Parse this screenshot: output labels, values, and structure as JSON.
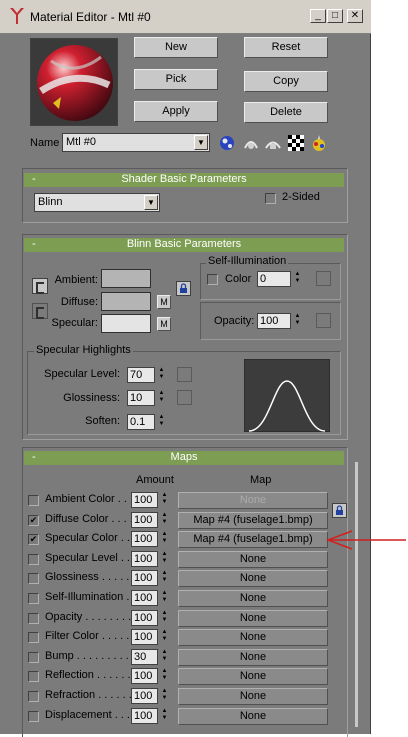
{
  "window": {
    "title": "Material Editor - Mtl #0",
    "minimize": "_",
    "maximize": "□",
    "close": "✕"
  },
  "top_buttons": {
    "new": "New",
    "reset": "Reset",
    "pick": "Pick",
    "copy": "Copy",
    "apply": "Apply",
    "delete": "Delete"
  },
  "name_row": {
    "label": "Name",
    "value": "Mtl #0"
  },
  "shader": {
    "title": "Shader Basic Parameters",
    "minus": "-",
    "shader_value": "Blinn",
    "two_sided": "2-Sided"
  },
  "blinn": {
    "title": "Blinn Basic Parameters",
    "minus": "-",
    "ambient": "Ambient:",
    "diffuse": "Diffuse:",
    "specular": "Specular:",
    "m": "M",
    "self_illum": {
      "title": "Self-Illumination",
      "color_label": "Color",
      "value": "0"
    },
    "opacity": {
      "label": "Opacity:",
      "value": "100"
    },
    "highlights": {
      "title": "Specular Highlights",
      "level_label": "Specular Level:",
      "level": "70",
      "gloss_label": "Glossiness:",
      "gloss": "10",
      "soften_label": "Soften:",
      "soften": "0.1"
    }
  },
  "maps": {
    "title": "Maps",
    "minus": "-",
    "amount_header": "Amount",
    "map_header": "Map",
    "rows": [
      {
        "label": "Ambient Color . . .",
        "checked": false,
        "amount": "100",
        "map": "None",
        "disabled": true
      },
      {
        "label": "Diffuse Color . . . .",
        "checked": true,
        "amount": "100",
        "map": "Map #4 (fuselage1.bmp)",
        "disabled": false
      },
      {
        "label": "Specular Color . .",
        "checked": true,
        "amount": "100",
        "map": "Map #4 (fuselage1.bmp)",
        "disabled": false
      },
      {
        "label": "Specular Level . .",
        "checked": false,
        "amount": "100",
        "map": "None",
        "disabled": false
      },
      {
        "label": "Glossiness  . . . . .",
        "checked": false,
        "amount": "100",
        "map": "None",
        "disabled": false
      },
      {
        "label": "Self-Illumination .",
        "checked": false,
        "amount": "100",
        "map": "None",
        "disabled": false
      },
      {
        "label": "Opacity . . . . . . . .",
        "checked": false,
        "amount": "100",
        "map": "None",
        "disabled": false
      },
      {
        "label": "Filter Color  . . . . .",
        "checked": false,
        "amount": "100",
        "map": "None",
        "disabled": false
      },
      {
        "label": "Bump  . . . . . . . . .",
        "checked": false,
        "amount": "30",
        "map": "None",
        "disabled": false
      },
      {
        "label": "Reflection  . . . . . .",
        "checked": false,
        "amount": "100",
        "map": "None",
        "disabled": false
      },
      {
        "label": "Refraction  . . . . . .",
        "checked": false,
        "amount": "100",
        "map": "None",
        "disabled": false
      },
      {
        "label": "Displacement  . . .",
        "checked": false,
        "amount": "100",
        "map": "None",
        "disabled": false
      }
    ]
  },
  "colors": {
    "panel": "#7b7b7b",
    "rollout": "#7d9e52",
    "annotation_arrow": "#d02020"
  },
  "icons": [
    "app-icon",
    "sample-sphere-icon",
    "get-material-icon",
    "put-to-scene-icon",
    "assign-material-icon",
    "checker-icon",
    "material-effects-icon",
    "lock-icon"
  ]
}
